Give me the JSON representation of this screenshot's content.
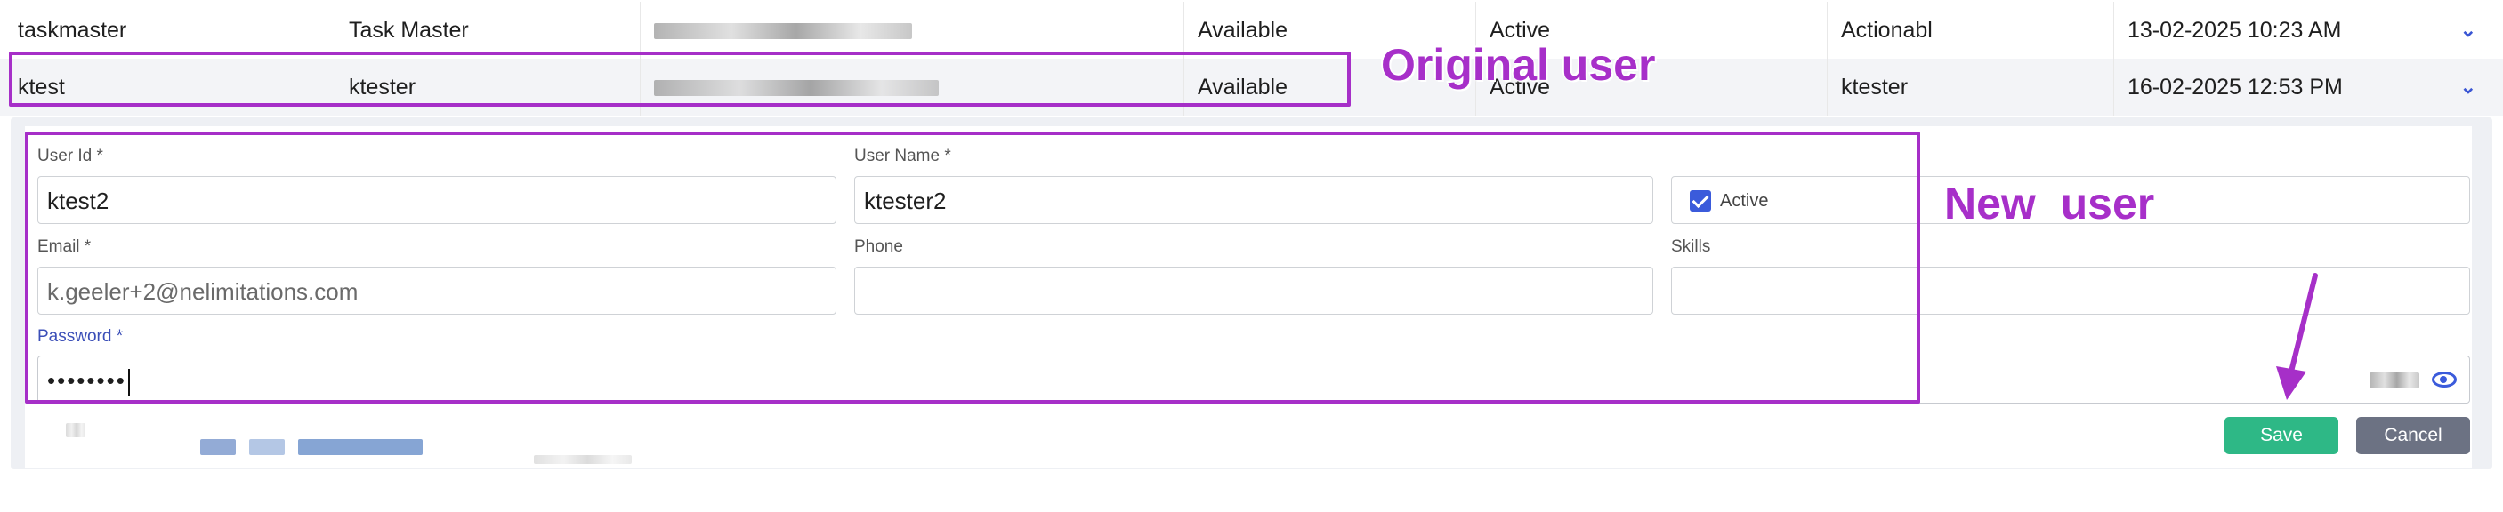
{
  "table": {
    "rows": [
      {
        "user_id": "taskmaster",
        "user_name": "Task Master",
        "status": "Available",
        "state": "Active",
        "role": "Actionabl",
        "date": "13-02-2025 10:23 AM"
      },
      {
        "user_id": "ktest",
        "user_name": "ktester",
        "status": "Available",
        "state": "Active",
        "role": "ktester",
        "date": "16-02-2025 12:53 PM"
      }
    ],
    "expand_glyph": "⌄"
  },
  "form": {
    "user_id_label": "User Id *",
    "user_id_value": "ktest2",
    "user_name_label": "User Name *",
    "user_name_value": "ktester2",
    "active_label": "Active",
    "email_label": "Email *",
    "email_value": "k.geeler+2@nelimitations.com",
    "phone_label": "Phone",
    "skills_label": "Skills",
    "password_label": "Password *",
    "password_value": "••••••••"
  },
  "buttons": {
    "save": "Save",
    "cancel": "Cancel"
  },
  "annotations": {
    "original": "Original user",
    "new": "New  user"
  },
  "colors": {
    "annotation": "#a62fc8",
    "save": "#2eb886",
    "cancel": "#6c7283",
    "accent": "#3b5bdb"
  }
}
